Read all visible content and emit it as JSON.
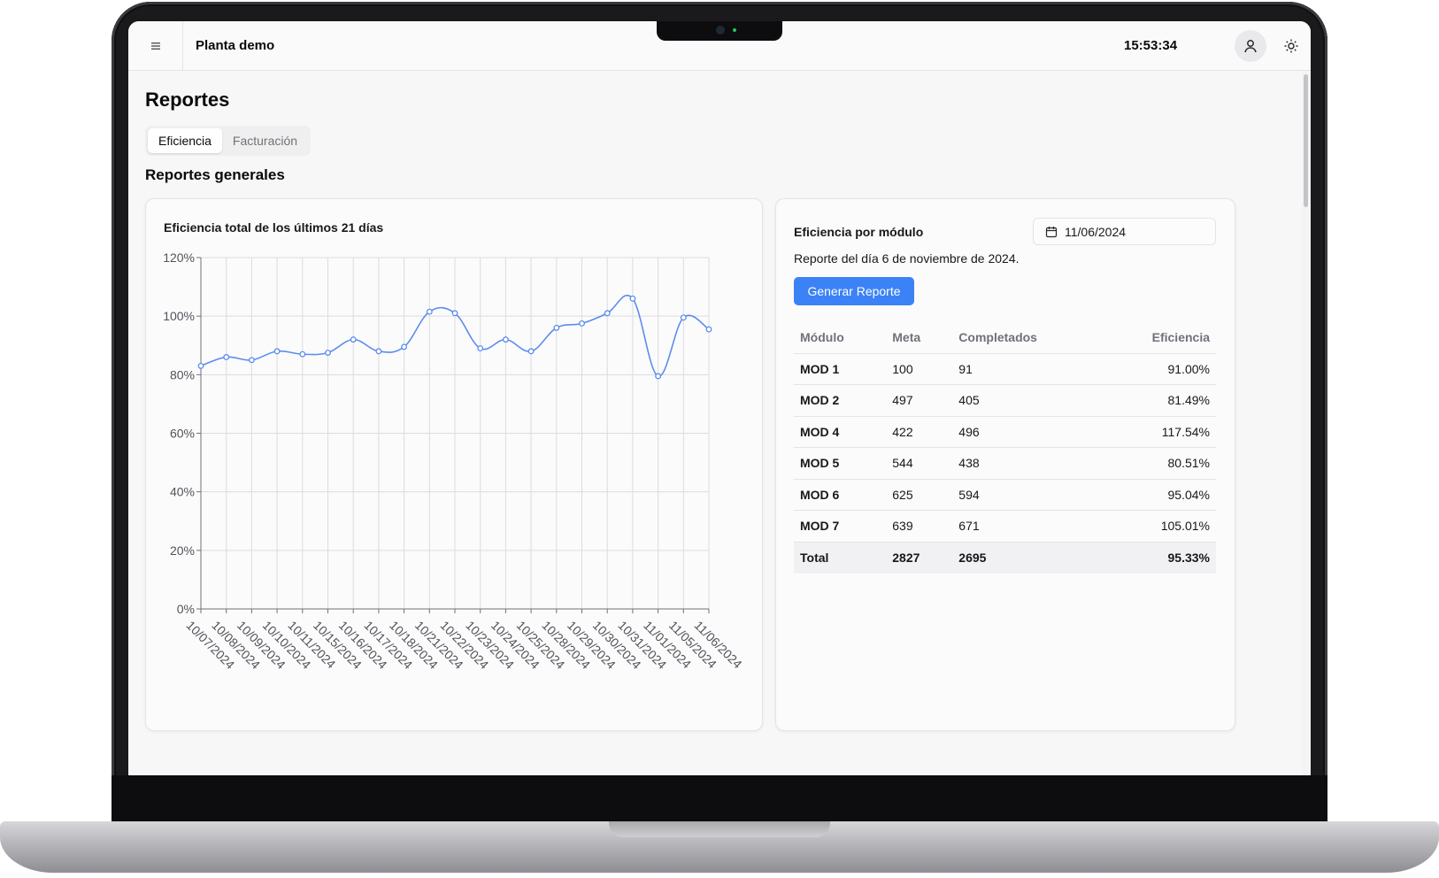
{
  "header": {
    "app_title": "Planta demo",
    "clock": "15:53:34",
    "menu_icon": "hamburger-icon",
    "user_icon": "user-icon",
    "theme_icon": "sun-icon"
  },
  "page": {
    "title": "Reportes",
    "tabs": [
      {
        "label": "Eficiencia",
        "active": true
      },
      {
        "label": "Facturación",
        "active": false
      }
    ],
    "section_title": "Reportes generales"
  },
  "chart_card": {
    "title": "Eficiencia total de los últimos 21 días"
  },
  "chart_data": {
    "type": "line",
    "title": "Eficiencia total de los últimos 21 días",
    "x": [
      "10/07/2024",
      "10/08/2024",
      "10/09/2024",
      "10/10/2024",
      "10/11/2024",
      "10/15/2024",
      "10/16/2024",
      "10/17/2024",
      "10/18/2024",
      "10/21/2024",
      "10/22/2024",
      "10/23/2024",
      "10/24/2024",
      "10/25/2024",
      "10/28/2024",
      "10/29/2024",
      "10/30/2024",
      "10/31/2024",
      "11/01/2024",
      "11/05/2024",
      "11/06/2024"
    ],
    "series": [
      {
        "values": [
          83,
          86,
          85,
          88,
          87,
          87.5,
          92,
          88,
          89.5,
          101.5,
          101,
          89,
          92,
          88,
          96,
          97.5,
          101,
          106,
          79.5,
          99.5,
          95.5
        ]
      }
    ],
    "ylim": [
      0,
      120
    ],
    "yticks": [
      "0%",
      "20%",
      "40%",
      "60%",
      "80%",
      "100%",
      "120%"
    ],
    "grid": true,
    "color": "#5b8def"
  },
  "module_card": {
    "title": "Eficiencia por módulo",
    "date_value": "11/06/2024",
    "date_icon": "calendar-icon",
    "report_text": "Reporte del día 6 de noviembre de 2024.",
    "button_label": "Generar Reporte",
    "button_color": "#3b82f6",
    "table": {
      "headers": [
        "Módulo",
        "Meta",
        "Completados",
        "Eficiencia"
      ],
      "rows": [
        [
          "MOD 1",
          "100",
          "91",
          "91.00%"
        ],
        [
          "MOD 2",
          "497",
          "405",
          "81.49%"
        ],
        [
          "MOD 4",
          "422",
          "496",
          "117.54%"
        ],
        [
          "MOD 5",
          "544",
          "438",
          "80.51%"
        ],
        [
          "MOD 6",
          "625",
          "594",
          "95.04%"
        ],
        [
          "MOD 7",
          "639",
          "671",
          "105.01%"
        ]
      ],
      "total": [
        "Total",
        "2827",
        "2695",
        "95.33%"
      ]
    }
  }
}
